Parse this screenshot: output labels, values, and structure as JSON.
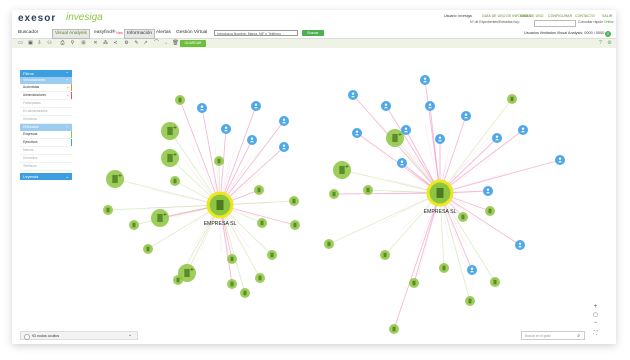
{
  "brand": {
    "main": "exesor",
    "sub": "invesiga"
  },
  "topbar": {
    "user": "Usuario: invesiga",
    "links": [
      "GUÍA DE USO DE INFORMES",
      "GUÍA DE USO",
      "CONFIGURAR",
      "CONTACTO",
      "SALIR"
    ],
    "entries_left": "Nº de Expedientes/Entradas hoy:",
    "consult_label": "Consultar rápido",
    "online": "Online"
  },
  "menu": {
    "items": [
      "Buscador",
      "Visual Analysis",
      "easyfind®",
      "Información",
      "Alertas",
      "Gestión Virtual"
    ],
    "new_badge": "New",
    "search_placeholder": "Introduzca Nombre, Marca, NIF o Teléfono",
    "search_button": "Buscar",
    "unlimited_text": "Usuarios ilimitados Visual Analysis: 0000 / 0000",
    "cart_count": "0"
  },
  "toolbar": {
    "icons": [
      "folder-icon",
      "save-icon",
      "export-icon",
      "people-icon",
      "print-icon",
      "filter-icon",
      "grid-icon",
      "close-icon",
      "network-icon",
      "share-icon",
      "settings-icon",
      "edit-icon",
      "link-icon",
      "curve-icon",
      "arrow-icon",
      "delete-icon"
    ],
    "action_button": "GUARDAR"
  },
  "sidebar": {
    "filters_title": "Filtros",
    "relations_title": "Vinculaciones",
    "relations": [
      {
        "label": "Accionistas",
        "mark": "+",
        "enabled": true,
        "color": "#f28c28"
      },
      {
        "label": "Administradores",
        "mark": "+",
        "enabled": true,
        "color": "#e0527c"
      },
      {
        "label": "Participadas",
        "mark": "",
        "enabled": false,
        "color": ""
      },
      {
        "label": "Ex administrados",
        "mark": "",
        "enabled": false,
        "color": ""
      },
      {
        "label": "Directivos",
        "mark": "",
        "enabled": false,
        "color": ""
      }
    ],
    "entities_title": "Entidades",
    "entities": [
      {
        "label": "Empresas",
        "enabled": true,
        "color": "#8cc63f"
      },
      {
        "label": "Ejecutivos",
        "enabled": true,
        "color": "#3d9fe0"
      },
      {
        "label": "Marcas",
        "enabled": false,
        "color": ""
      },
      {
        "label": "Domicilios",
        "enabled": false,
        "color": ""
      },
      {
        "label": "Teléfonos",
        "enabled": false,
        "color": ""
      }
    ],
    "legend_title": "Leyenda"
  },
  "graph": {
    "center_labels": [
      "EMPRESA SL",
      "EMPRESA SL"
    ],
    "colors": {
      "company": "#8cc63f",
      "person": "#4fa8e8",
      "center_ring": "#f0e61e",
      "edge_pink": "#e667a5",
      "edge_green": "#b5d98a"
    }
  },
  "bottom": {
    "hidden_label": "93 nodos ocultos",
    "search_placeholder": "Buscar en el grafo"
  },
  "zoom": {
    "plus": "+",
    "minus": "−"
  }
}
